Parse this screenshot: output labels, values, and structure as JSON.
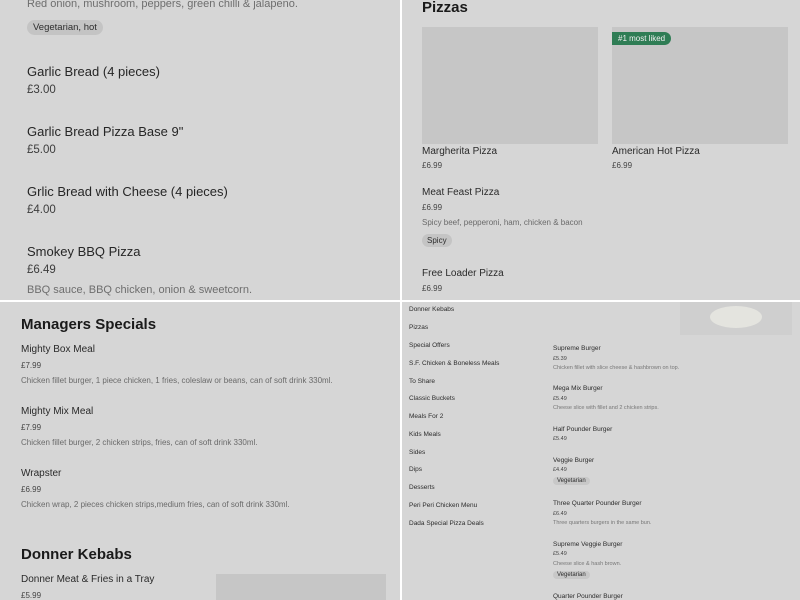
{
  "top_left": {
    "partial_desc": "Red onion, mushroom, peppers, green chilli & jalapeno.",
    "partial_tag": "Vegetarian, hot",
    "items": [
      {
        "name": "Garlic Bread (4 pieces)",
        "price": "£3.00"
      },
      {
        "name": "Garlic Bread Pizza Base 9\"",
        "price": "£5.00"
      },
      {
        "name": "Grlic Bread with Cheese (4 pieces)",
        "price": "£4.00"
      },
      {
        "name": "Smokey BBQ Pizza",
        "price": "£6.49",
        "desc": "BBQ sauce, BBQ chicken, onion & sweetcorn."
      }
    ]
  },
  "top_right": {
    "section_title": "Pizzas",
    "badge": "#1 most liked",
    "cards": [
      {
        "name": "Margherita Pizza",
        "price": "£6.99"
      },
      {
        "name": "American Hot Pizza",
        "price": "£6.99"
      }
    ],
    "items": [
      {
        "name": "Meat Feast Pizza",
        "price": "£6.99",
        "desc": "Spicy beef, pepperoni, ham, chicken & bacon",
        "tag": "Spicy"
      },
      {
        "name": "Free Loader Pizza",
        "price": "£6.99"
      }
    ]
  },
  "bottom_left": {
    "section_title": "Managers Specials",
    "items": [
      {
        "name": "Mighty Box Meal",
        "price": "£7.99",
        "desc": "Chicken fillet burger, 1 piece chicken, 1 fries, coleslaw or beans, can of soft drink 330ml."
      },
      {
        "name": "Mighty Mix Meal",
        "price": "£7.99",
        "desc": "Chicken fillet burger, 2 chicken strips, fries, can of soft drink 330ml."
      },
      {
        "name": "Wrapster",
        "price": "£6.99",
        "desc": "Chicken wrap, 2 pieces chicken strips,medium fries, can of soft drink 330ml."
      }
    ],
    "section2_title": "Donner Kebabs",
    "section2_items": [
      {
        "name": "Donner Meat & Fries in a Tray",
        "price": "£5.99"
      }
    ]
  },
  "bottom_right": {
    "nav": [
      "Donner Kebabs",
      "Pizzas",
      "Special Offers",
      "S.F. Chicken & Boneless Meals",
      "To Share",
      "Classic Buckets",
      "Meals For 2",
      "Kids Meals",
      "Sides",
      "Dips",
      "Desserts",
      "Peri Peri Chicken Menu",
      "Dada Special Pizza Deals"
    ],
    "burgers": [
      {
        "name": "Supreme Burger",
        "price": "£5.39",
        "desc": "Chicken fillet with slice cheese & hashbrown on top."
      },
      {
        "name": "Mega Mix Burger",
        "price": "£5.49",
        "desc": "Cheese slice with fillet and 2 chicken strips."
      },
      {
        "name": "Half Pounder Burger",
        "price": "£5.49"
      },
      {
        "name": "Veggie Burger",
        "price": "£4.49",
        "tag": "Vegetarian"
      },
      {
        "name": "Three Quarter Pounder Burger",
        "price": "£6.49",
        "desc": "Three quarters burgers in the same bun."
      },
      {
        "name": "Supreme Veggie Burger",
        "price": "£5.49",
        "desc": "Cheese slice & hash brown.",
        "tag": "Vegetarian"
      },
      {
        "name": "Quarter Pounder Burger"
      }
    ]
  }
}
